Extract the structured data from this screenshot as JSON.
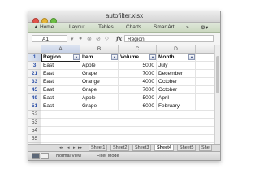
{
  "window": {
    "title": "autofilter.xlsx"
  },
  "ribbon": {
    "tabs": [
      "Home",
      "Layout",
      "Tables",
      "Charts",
      "SmartArt"
    ],
    "more": "»"
  },
  "formula_bar": {
    "cell_ref": "A1",
    "fx": "fx",
    "value": "Region"
  },
  "columns": [
    "A",
    "B",
    "C",
    "D"
  ],
  "header_row": {
    "number": "1",
    "cells": [
      "Region",
      "Item",
      "Volume",
      "Month"
    ]
  },
  "rows": [
    {
      "number": "3",
      "region": "East",
      "item": "Apple",
      "volume": "5000",
      "month": "July"
    },
    {
      "number": "21",
      "region": "East",
      "item": "Grape",
      "volume": "7000",
      "month": "December"
    },
    {
      "number": "33",
      "region": "East",
      "item": "Orange",
      "volume": "4000",
      "month": "October"
    },
    {
      "number": "45",
      "region": "East",
      "item": "Grape",
      "volume": "7000",
      "month": "October"
    },
    {
      "number": "49",
      "region": "East",
      "item": "Apple",
      "volume": "5000",
      "month": "April"
    },
    {
      "number": "51",
      "region": "East",
      "item": "Grape",
      "volume": "6000",
      "month": "February"
    }
  ],
  "empty_rows": [
    "52",
    "53",
    "54",
    "55",
    "56",
    "57"
  ],
  "sheets": [
    "Sheet1",
    "Sheet2",
    "Sheet3",
    "Sheet4",
    "Sheet5",
    "She"
  ],
  "active_sheet": "Sheet4",
  "status": {
    "view": "Normal View",
    "mode": "Filter Mode"
  }
}
